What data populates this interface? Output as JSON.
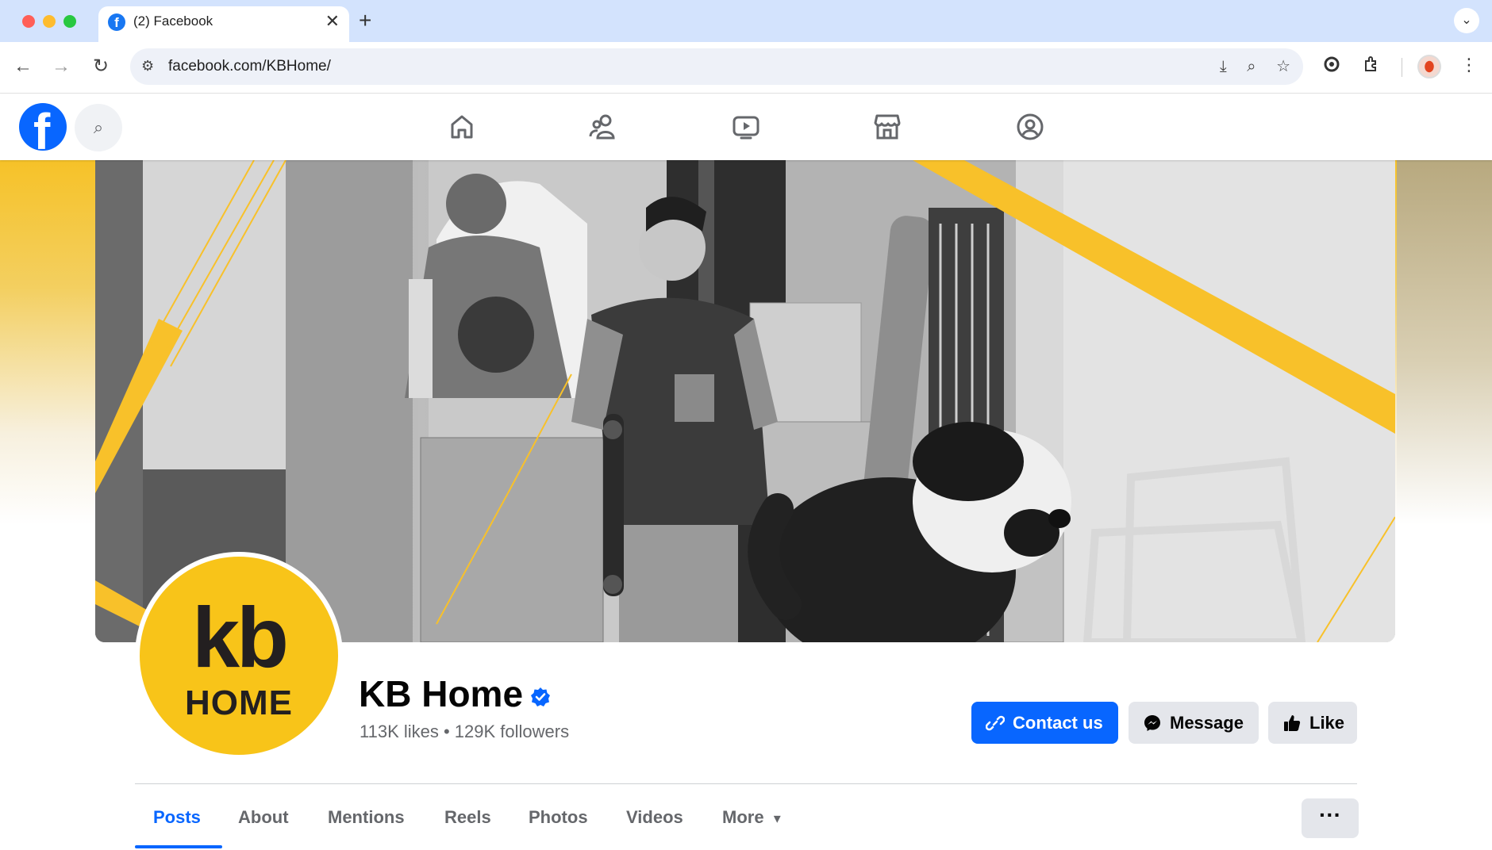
{
  "browser": {
    "tab_title": "(2) Facebook",
    "tab_close": "✕",
    "new_tab": "+",
    "tab_menu": "⌄",
    "url": "facebook.com/KBHome/",
    "favicon_letter": "f",
    "nav_back": "←",
    "nav_forward": "→",
    "nav_reload": "↻",
    "tune_icon": "⚙",
    "right_icons": [
      "⤓",
      "⌕",
      "☆"
    ],
    "menu_dots": "⋮"
  },
  "facebook": {
    "logo_letter": "f",
    "search_icon": "⌕",
    "accent": "#0866ff",
    "tabs": [
      "home-tab",
      "friends-tab",
      "watch-tab",
      "marketplace-tab",
      "profile-tab"
    ]
  },
  "page": {
    "name": "KB Home",
    "stats": "113K likes • 129K followers",
    "profile_logo_line1": "kb",
    "profile_logo_line2": "HOME",
    "brand_color": "#f8c419",
    "buttons": {
      "contact": "Contact us",
      "message": "Message",
      "like": "Like"
    },
    "tabs": [
      "Posts",
      "About",
      "Mentions",
      "Reels",
      "Photos",
      "Videos",
      "More"
    ],
    "more_caret": "▾",
    "overflow": "···"
  }
}
